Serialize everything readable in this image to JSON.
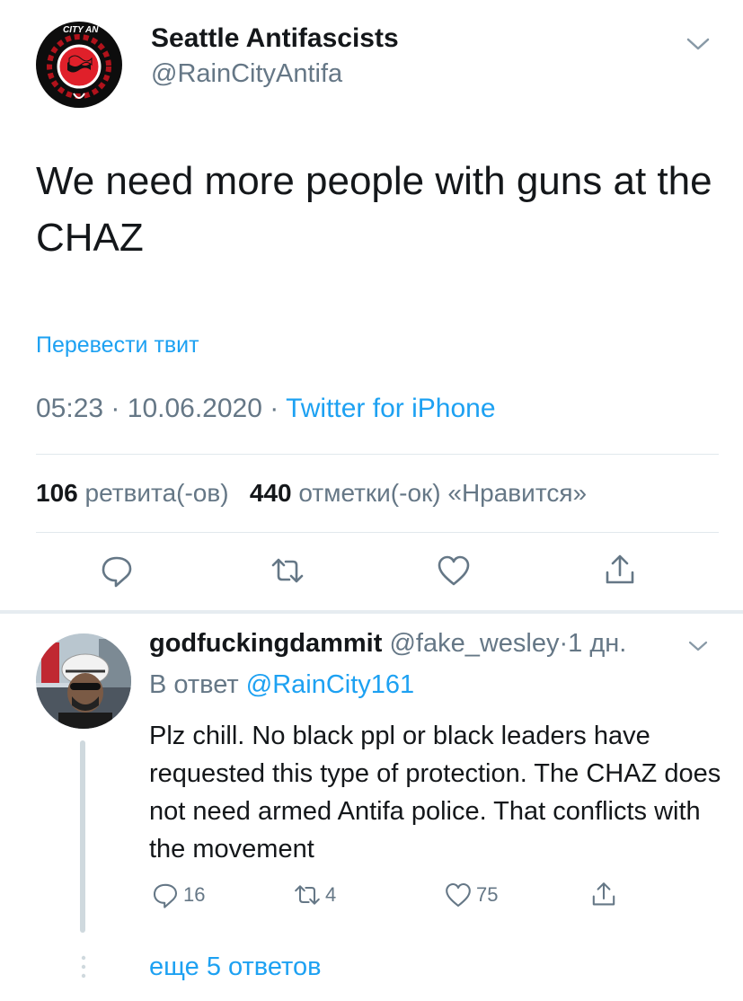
{
  "tweet": {
    "display_name": "Seattle Antifascists",
    "handle": "@RainCityAntifa",
    "avatar_icon": "antifa-flag-logo-icon",
    "avatar_text": "CITY AN",
    "text": "We need more people with guns at the CHAZ",
    "translate_label": "Перевести твит",
    "time": "05:23",
    "date": "10.06.2020",
    "source": "Twitter for iPhone",
    "retweet_count": "106",
    "retweet_label": "ретвита(-ов)",
    "like_count": "440",
    "like_label": "отметки(-ок) «Нравится»"
  },
  "reply": {
    "display_name": "godfuckingdammit",
    "handle": "@fake_wesley",
    "age": "1 дн.",
    "in_reply_prefix": "В ответ",
    "in_reply_mention": "@RainCity161",
    "text": "Plz chill. No black ppl or black leaders have requested this type of protection. The CHAZ does not need armed Antifa police. That conflicts with the movement",
    "reply_count": "16",
    "retweet_count": "4",
    "like_count": "75"
  },
  "more_replies_label": "еще 5 ответов",
  "colors": {
    "accent": "#1da1f2",
    "secondary_text": "#657786",
    "divider": "#e1e8ed",
    "antifa_red": "#e0202a"
  },
  "icons": [
    "reply-icon",
    "retweet-icon",
    "like-icon",
    "share-icon",
    "chevron-down-icon"
  ]
}
